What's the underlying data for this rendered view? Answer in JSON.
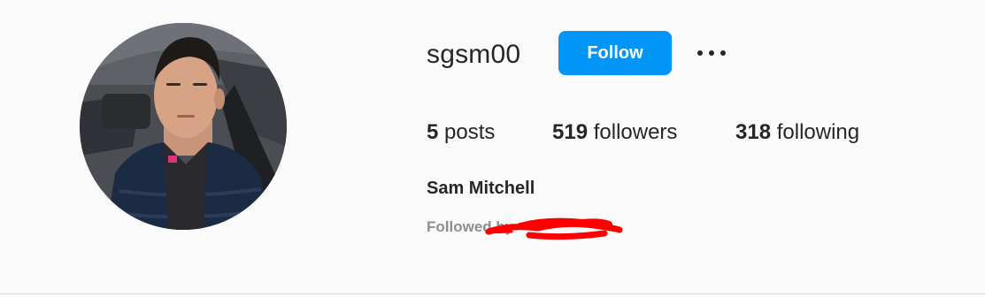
{
  "profile": {
    "username": "sgsm00",
    "follow_label": "Follow",
    "more_options": "more-options-icon",
    "full_name": "Sam Mitchell",
    "followed_by_label": "Followed by",
    "stats": {
      "posts_count": "5",
      "posts_label": "posts",
      "followers_count": "519",
      "followers_label": "followers",
      "following_count": "318",
      "following_label": "following"
    }
  },
  "colors": {
    "accent": "#0095f6",
    "background": "#fafafa",
    "text": "#262626",
    "muted": "#8e8e8e",
    "redaction": "#ff0000"
  }
}
